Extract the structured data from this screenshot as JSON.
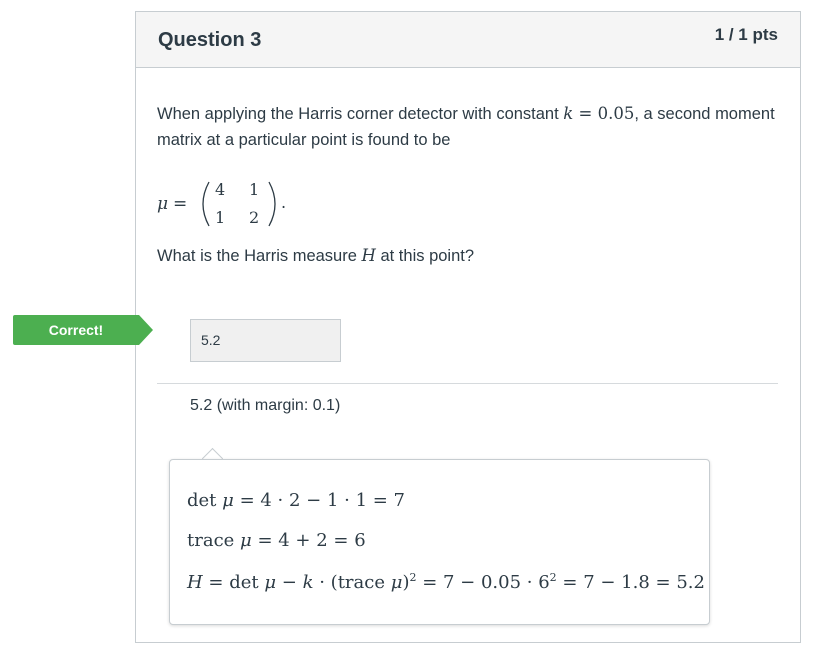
{
  "question": {
    "title": "Question 3",
    "points": "1 / 1 pts",
    "intro_prefix": "When applying the Harris corner detector with constant ",
    "k_symbol": "k",
    "k_equals": " = 0.05",
    "intro_suffix": ", a second moment matrix at a particular point is found to be",
    "mu_symbol": "μ",
    "mu_equals": "=",
    "matrix": [
      [
        "4",
        "1"
      ],
      [
        "1",
        "2"
      ]
    ],
    "matrix_period": ".",
    "prompt_prefix": "What is the Harris measure ",
    "h_symbol": "H",
    "prompt_suffix": " at this point?"
  },
  "answer": {
    "badge": "Correct!",
    "value": "5.2",
    "margin_text": "5.2 (with margin: 0.1)"
  },
  "explanation": {
    "det_op": "det ",
    "det_mu": "μ",
    "det_rest": " = 4 · 2 − 1 · 1 = 7",
    "trace_op": "trace ",
    "trace_mu": "μ",
    "trace_rest": " = 4 + 2 = 6",
    "h_lhs": "H",
    "h_a": " = det ",
    "h_mu1": "μ",
    "h_b": " − ",
    "h_k": "k",
    "h_c": " · (trace ",
    "h_mu2": "μ",
    "h_d": ")",
    "h_exp": "2",
    "h_e": " = 7 − 0.05 · 6",
    "h_exp2": "2",
    "h_f": " = 7 − 1.8 = 5.2"
  },
  "colors": {
    "correct": "#4caf50",
    "text": "#2d3b45",
    "border": "#c7cdd1",
    "header": "#f5f5f5"
  }
}
